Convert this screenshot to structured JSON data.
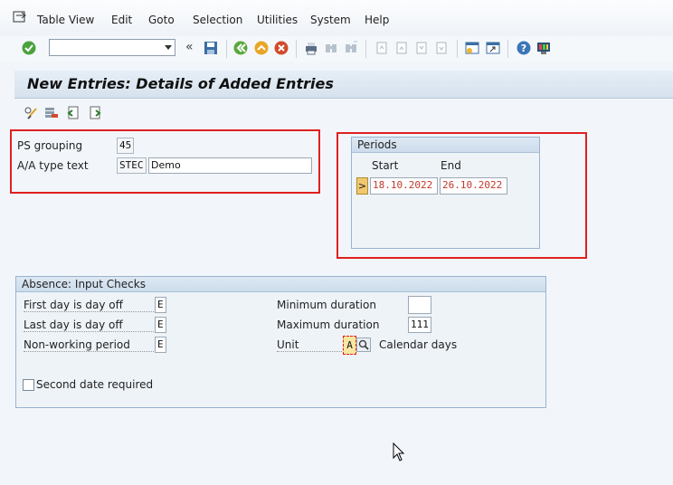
{
  "menu": [
    {
      "label": "Table View"
    },
    {
      "label": "Edit"
    },
    {
      "label": "Goto"
    },
    {
      "label": "Selection"
    },
    {
      "label": "Utilities"
    },
    {
      "label": "System"
    },
    {
      "label": "Help"
    }
  ],
  "toolbar": {
    "command_field_value": "",
    "icons": [
      "enter-icon",
      "save-icon",
      "back-icon",
      "exit-icon",
      "cancel-icon",
      "print-icon",
      "find-icon",
      "find-next-icon",
      "first-page-icon",
      "previous-page-icon",
      "next-page-icon",
      "last-page-icon",
      "create-session-icon",
      "shortcut-icon",
      "help-icon",
      "customize-layout-icon"
    ]
  },
  "title": "New Entries: Details of Added Entries",
  "fields": {
    "ps_grouping_label": "PS grouping",
    "ps_grouping_value": "45",
    "aa_type_text_label": "A/A type text",
    "aa_type_code": "STEC",
    "aa_type_text_value": "Demo"
  },
  "periods": {
    "title": "Periods",
    "start_label": "Start",
    "end_label": "End",
    "row_selector": ">",
    "start_value": "18.10.2022",
    "end_value": "26.10.2022"
  },
  "absence_checks": {
    "title": "Absence: Input Checks",
    "first_day_label": "First day is day off",
    "first_day_value": "E",
    "last_day_label": "Last day is day off",
    "last_day_value": "E",
    "non_working_label": "Non-working period",
    "non_working_value": "E",
    "min_duration_label": "Minimum duration",
    "min_duration_value": "",
    "max_duration_label": "Maximum duration",
    "max_duration_value": "111",
    "unit_label": "Unit",
    "unit_value": "A",
    "unit_text": "Calendar days",
    "second_date_label": "Second date required",
    "second_date_checked": false
  },
  "colors": {
    "highlight_border": "#e02020",
    "date_text": "#c0392b"
  }
}
